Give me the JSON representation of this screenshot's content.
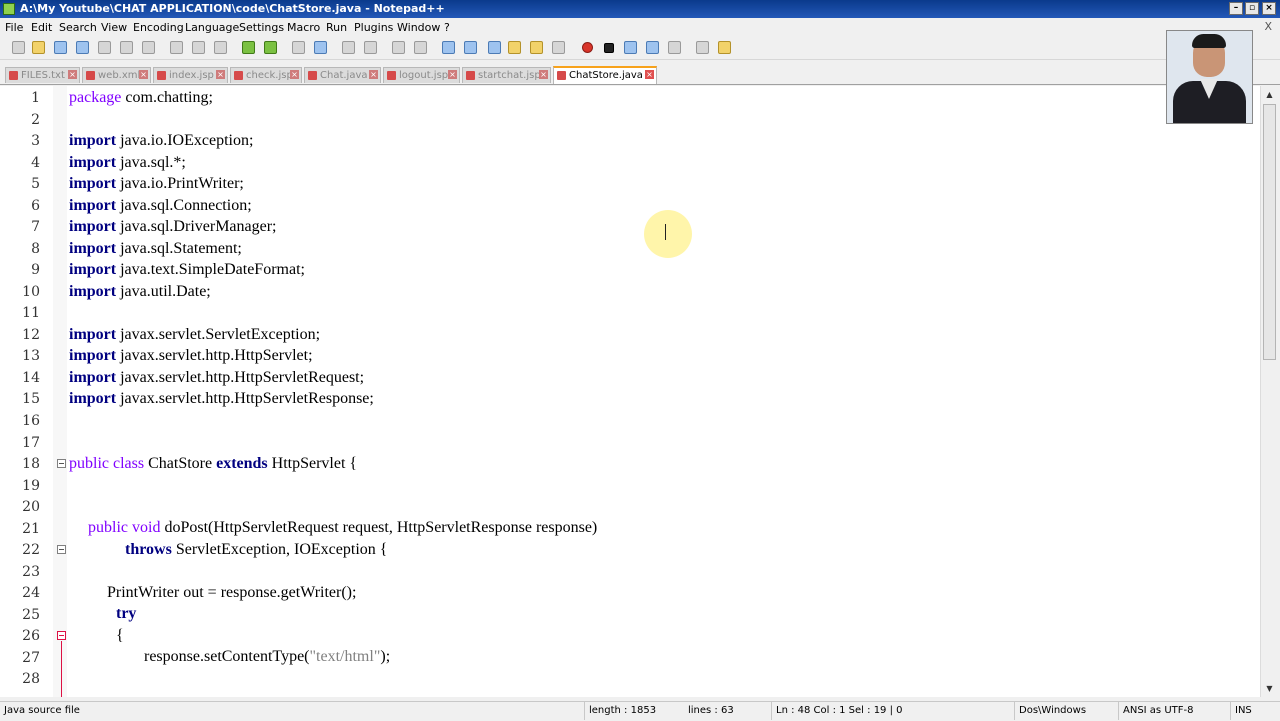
{
  "window": {
    "title": "A:\\My Youtube\\CHAT APPLICATION\\code\\ChatStore.java - Notepad++"
  },
  "menu": [
    "File",
    "Edit",
    "Search",
    "View",
    "Encoding",
    "Language",
    "Settings",
    "Macro",
    "Run",
    "Plugins",
    "Window",
    "?"
  ],
  "menu_close": "X",
  "tabs": [
    {
      "label": "FILES.txt",
      "active": false
    },
    {
      "label": "web.xml",
      "active": false
    },
    {
      "label": "index.jsp",
      "active": false
    },
    {
      "label": "check.jsp",
      "active": false
    },
    {
      "label": "Chat.java",
      "active": false
    },
    {
      "label": "logout.jsp",
      "active": false
    },
    {
      "label": "startchat.jsp",
      "active": false
    },
    {
      "label": "ChatStore.java",
      "active": true
    }
  ],
  "editor": {
    "line_numbers": [
      "1",
      "2",
      "3",
      "4",
      "5",
      "6",
      "7",
      "8",
      "9",
      "10",
      "11",
      "12",
      "13",
      "14",
      "15",
      "16",
      "17",
      "18",
      "19",
      "20",
      "21",
      "22",
      "23",
      "24",
      "25",
      "26",
      "27",
      "28"
    ],
    "lines": {
      "l1_kw": "package",
      "l1_rest": " com.chatting;",
      "import_kw": "import",
      "l3": " java.io.IOException;",
      "l4": " java.sql.*;",
      "l5": " java.io.PrintWriter;",
      "l6": " java.sql.Connection;",
      "l7": " java.sql.DriverManager;",
      "l8": " java.sql.Statement;",
      "l9": " java.text.SimpleDateFormat;",
      "l10": " java.util.Date;",
      "l12": " javax.servlet.ServletException;",
      "l13": " javax.servlet.http.HttpServlet;",
      "l14": " javax.servlet.http.HttpServletRequest;",
      "l15": " javax.servlet.http.HttpServletResponse;",
      "l18_mod": "public class",
      "l18_name": " ChatStore ",
      "l18_ext": "extends",
      "l18_rest": " HttpServlet {",
      "l21_mod": "public void",
      "l21_rest": " doPost(HttpServletRequest request, HttpServletResponse response)",
      "l22_kw": "throws",
      "l22_rest": " ServletException, IOException {",
      "l24": "PrintWriter out = response.getWriter();",
      "l25": "try",
      "l26": "{",
      "l27_a": "response.setContentType(",
      "l27_str": "\"text/html\"",
      "l27_b": ");"
    }
  },
  "status": {
    "file_type": "Java source file",
    "length": "length : 1853",
    "lines": "lines : 63",
    "position": "Ln : 48    Col : 1    Sel : 19 | 0",
    "eol": "Dos\\Windows",
    "encoding": "ANSI as UTF-8",
    "mode": "INS"
  }
}
